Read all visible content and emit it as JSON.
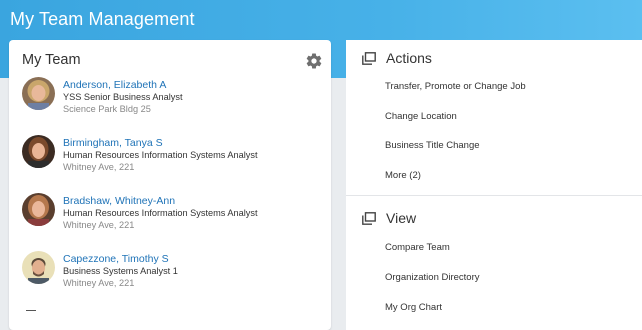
{
  "header": {
    "title": "My Team Management"
  },
  "team": {
    "title": "My Team",
    "members": [
      {
        "name": "Anderson, Elizabeth A",
        "title": "YSS Senior Business Analyst",
        "location": "Science Park Bldg 25"
      },
      {
        "name": "Birmingham, Tanya S",
        "title": "Human Resources Information Systems Analyst",
        "location": "Whitney Ave, 221"
      },
      {
        "name": "Bradshaw, Whitney-Ann",
        "title": "Human Resources Information Systems Analyst",
        "location": "Whitney Ave, 221"
      },
      {
        "name": "Capezzone, Timothy S",
        "title": "Business Systems Analyst 1",
        "location": "Whitney Ave, 221"
      }
    ]
  },
  "actions": {
    "title": "Actions",
    "items": [
      "Transfer, Promote or Change Job",
      "Change Location",
      "Business Title Change",
      "More (2)"
    ]
  },
  "view": {
    "title": "View",
    "items": [
      "Compare Team",
      "Organization Directory",
      "My Org Chart"
    ]
  },
  "icons": {
    "settings": "gear-icon",
    "section": "window-icon"
  },
  "colors": {
    "header_blue": "#3aa5df",
    "link_blue": "#1f73b7"
  }
}
